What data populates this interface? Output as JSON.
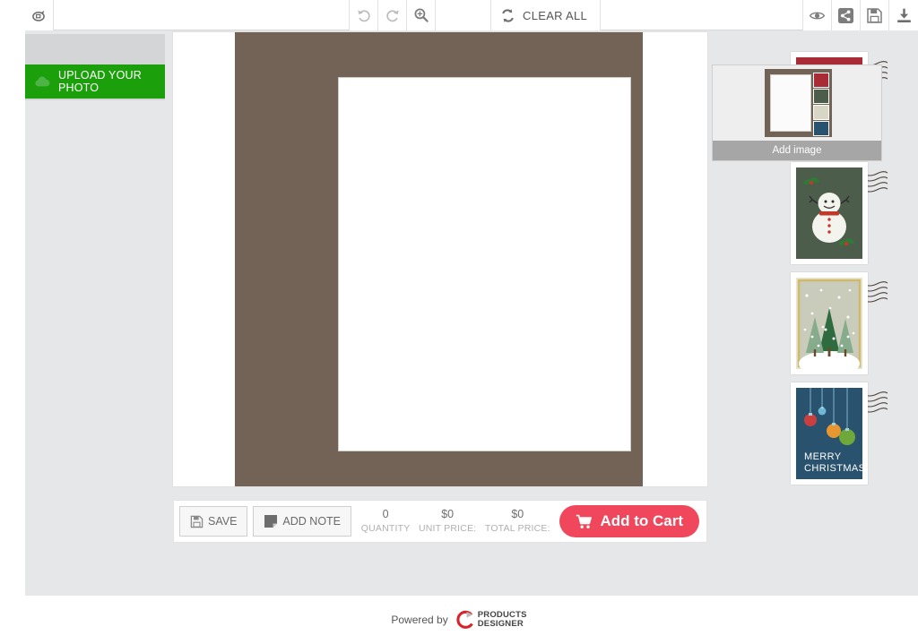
{
  "toolbar": {
    "logo_icon": "circle-arrow-icon",
    "text_input_value": "",
    "undo_icon": "undo-icon",
    "redo_icon": "redo-icon",
    "zoom_icon": "zoom-in-icon",
    "clear_all_label": "CLEAR ALL",
    "clear_all_icon": "refresh-icon",
    "preview_icon": "eye-icon",
    "share_icon": "share-icon",
    "save_icon": "floppy-disk-icon",
    "download_icon": "download-icon"
  },
  "sidebar": {
    "upload_label": "UPLOAD YOUR PHOTO",
    "upload_icon": "cloud-upload-icon"
  },
  "canvas": {
    "mat_color": "#726356",
    "inner_color": "#ffffff",
    "background_color": "#ffffff",
    "stamps": [
      {
        "name": "christmas-trees-stamp",
        "bg": "#a92b35",
        "caption": "",
        "motif": "white-christmas-trees"
      },
      {
        "name": "snowman-stamp",
        "bg": "#4d5d4b",
        "caption": "",
        "motif": "snowman-with-holly"
      },
      {
        "name": "winter-pines-stamp",
        "bg": "#ccd0c0",
        "caption": "",
        "motif": "snowy-pine-trees"
      },
      {
        "name": "merry-christmas-stamp",
        "bg": "#29526e",
        "caption": "MERRY\nCHRISTMAS",
        "caption_line1": "MERRY",
        "caption_line2": "CHRISTMAS",
        "motif": "hanging-ornaments"
      }
    ]
  },
  "right_panel": {
    "add_image_label": "Add image"
  },
  "action_bar": {
    "save_label": "SAVE",
    "save_icon": "floppy-disk-icon",
    "add_note_label": "ADD NOTE",
    "add_note_icon": "note-icon",
    "quantity_value": "0",
    "quantity_label": "QUANTITY",
    "unit_price_value": "$0",
    "unit_price_label": "UNIT PRICE:",
    "total_price_value": "$0",
    "total_price_label": "TOTAL PRICE:",
    "cart_label": "Add to Cart",
    "cart_icon": "shopping-cart-icon",
    "cart_color": "#f0475c"
  },
  "footer": {
    "powered_by": "Powered by",
    "brand_line1": "PRODUCTS",
    "brand_line2": "DESIGNER",
    "brand_icon": "products-designer-logo"
  }
}
